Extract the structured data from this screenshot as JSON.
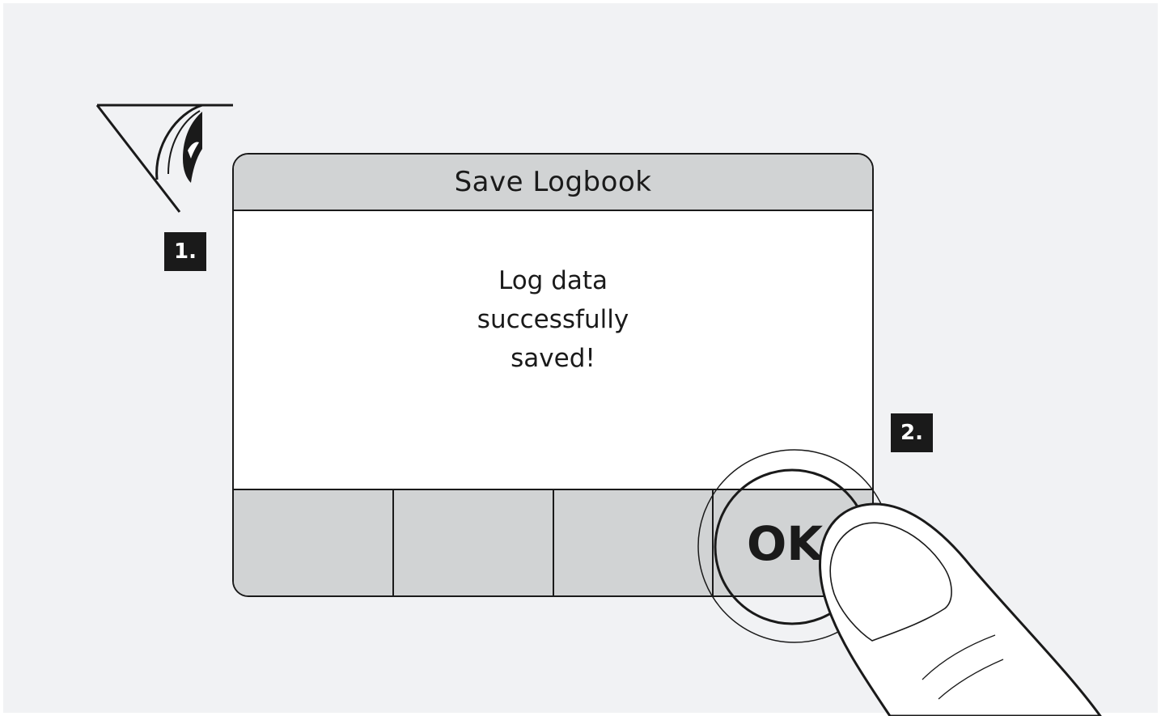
{
  "dialog": {
    "title": "Save Logbook",
    "message_lines": [
      "Log data",
      "successfully",
      "saved!"
    ]
  },
  "softkeys": [
    {
      "label": ""
    },
    {
      "label": ""
    },
    {
      "label": ""
    },
    {
      "label": "OK"
    }
  ],
  "steps": {
    "step1": "1.",
    "step2": "2."
  },
  "icons": {
    "view": "eye-view-icon",
    "press": "finger-press-icon",
    "press_ring": "press-ring-icon"
  },
  "colors": {
    "background": "#f1f2f4",
    "header_gray": "#d1d3d4",
    "ink": "#1a1a1a",
    "body": "#ffffff"
  }
}
